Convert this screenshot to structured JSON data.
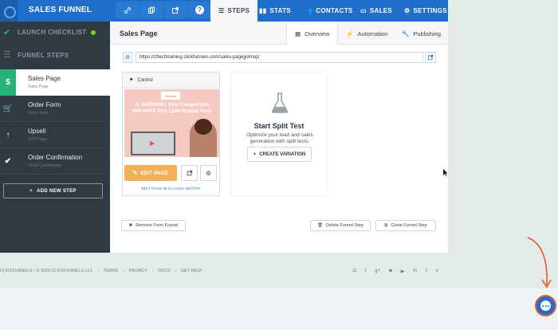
{
  "brand": "SALES FUNNEL",
  "toolbar": {
    "link_icon": "link-icon",
    "copy_icon": "copy-icon",
    "external_icon": "external-link-icon",
    "help_icon": "help-icon",
    "help_glyph": "?"
  },
  "tabs": [
    {
      "label": "STEPS",
      "icon": "steps-icon",
      "active": true
    },
    {
      "label": "STATS",
      "icon": "stats-icon"
    },
    {
      "label": "CONTACTS",
      "icon": "contacts-icon"
    },
    {
      "label": "SALES",
      "icon": "sales-icon"
    },
    {
      "label": "SETTINGS",
      "icon": "settings-icon"
    }
  ],
  "sidebar": {
    "launch_checklist": "LAUNCH CHECKLIST",
    "funnel_steps": "FUNNEL STEPS",
    "steps": [
      {
        "name": "Sales Page",
        "sub": "Sales Page",
        "icon_glyph": "$",
        "active": true
      },
      {
        "name": "Order Form",
        "sub": "Order Form",
        "icon_glyph": "🛒"
      },
      {
        "name": "Upsell",
        "sub": "OTO Page",
        "icon_glyph": "↑"
      },
      {
        "name": "Order Confirmation",
        "sub": "Order Confirmation",
        "icon_glyph": "✔"
      }
    ],
    "add_step": "ADD NEW STEP"
  },
  "main": {
    "title": "Sales Page",
    "subtabs": [
      {
        "label": "Overview",
        "active": true
      },
      {
        "label": "Automation"
      },
      {
        "label": "Publishing"
      }
    ],
    "url": "https://cftechtraining.clickfunnels.com/sales-pagejjolmujz",
    "variant": {
      "label": "Control",
      "preview_logo": "Secrets",
      "preview_headline": "⚠ WARNING: Your Competitors Will HATE This Little-Known Tool!",
      "edit_button": "EDIT PAGE",
      "classic_link": "EDIT PAGE IN CLASSIC EDITOR"
    },
    "split": {
      "title": "Start Split Test",
      "desc": "Optimize your lead and sales generation with split tests.",
      "button": "CREATE VARIATION"
    },
    "footer_buttons": {
      "remove": "Remove From Funnel",
      "delete": "Delete Funnel Step",
      "clone": "Clone Funnel Step"
    }
  },
  "footer": {
    "copyright": "CLICKFUNNELS • © 2020 CLICKFUNNELS LLC",
    "links": [
      "TERMS",
      "PRIVACY",
      "DOCS",
      "GET HELP"
    ],
    "social": [
      "instagram-icon",
      "facebook-icon",
      "google-plus-icon",
      "instagram-icon",
      "youtube-icon",
      "linkedin-icon",
      "twitter-icon",
      "vimeo-icon"
    ]
  },
  "colors": {
    "topbar": "#1d6fc9",
    "sidebar": "#2f3a42",
    "active_step": "#2ab27b",
    "edit_button": "#f2b05b",
    "annotation": "#e85a2a"
  }
}
